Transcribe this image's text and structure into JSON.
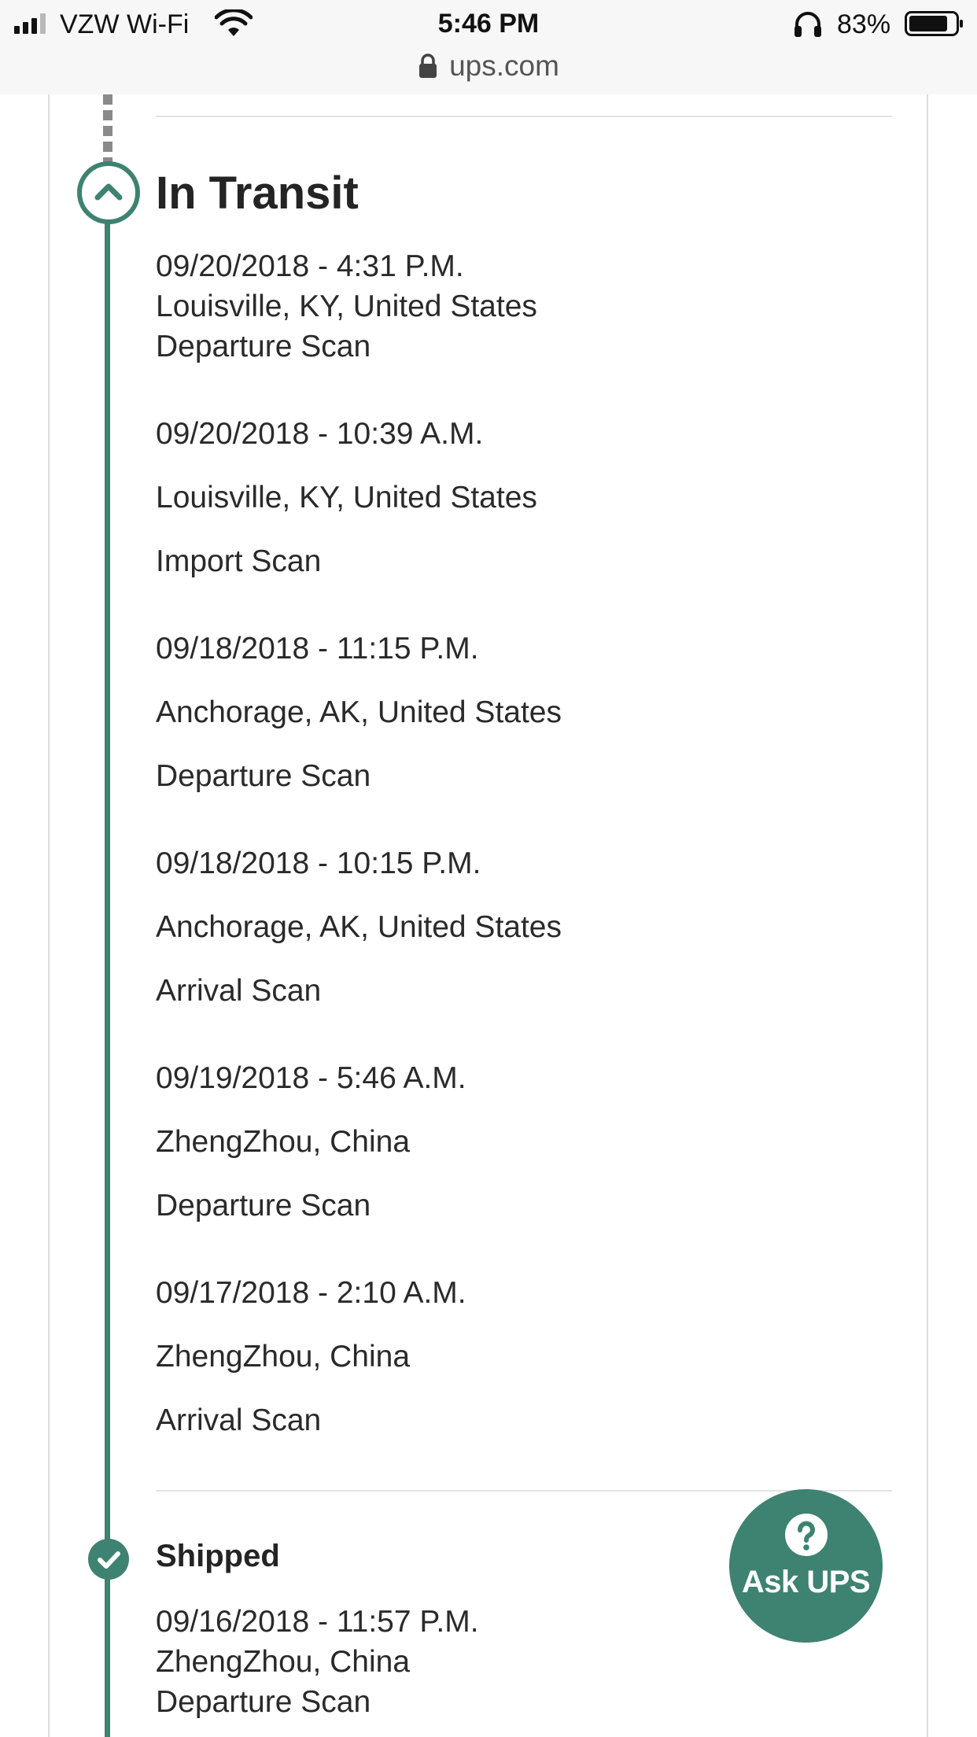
{
  "status_bar": {
    "carrier": "VZW Wi-Fi",
    "time": "5:46 PM",
    "battery": "83%"
  },
  "browser": {
    "url": "ups.com"
  },
  "transit": {
    "title": "In Transit",
    "events": [
      {
        "datetime": "09/20/2018 - 4:31 P.M.",
        "location": "Louisville, KY, United States",
        "activity": "Departure Scan"
      },
      {
        "datetime": "09/20/2018 - 10:39 A.M.",
        "location": "Louisville, KY, United States",
        "activity": "Import Scan"
      },
      {
        "datetime": "09/18/2018 - 11:15 P.M.",
        "location": "Anchorage, AK, United States",
        "activity": "Departure Scan"
      },
      {
        "datetime": "09/18/2018 - 10:15 P.M.",
        "location": "Anchorage, AK, United States",
        "activity": "Arrival Scan"
      },
      {
        "datetime": "09/19/2018 - 5:46 A.M.",
        "location": "ZhengZhou, China",
        "activity": "Departure Scan"
      },
      {
        "datetime": "09/17/2018 - 2:10 A.M.",
        "location": "ZhengZhou, China",
        "activity": "Arrival Scan"
      }
    ]
  },
  "shipped": {
    "title": "Shipped",
    "events": [
      {
        "datetime": "09/16/2018 - 11:57 P.M.",
        "location": "ZhengZhou, China",
        "activity": "Departure Scan"
      }
    ]
  },
  "ask_ups": {
    "label": "Ask UPS"
  },
  "colors": {
    "accent": "#3e8271",
    "divider": "#e3e3e3",
    "text": "#242424"
  },
  "icons": [
    "signal-icon",
    "wifi-icon",
    "headphones-icon",
    "battery-icon",
    "lock-icon",
    "chevron-up-icon",
    "checkmark-icon",
    "question-icon"
  ]
}
